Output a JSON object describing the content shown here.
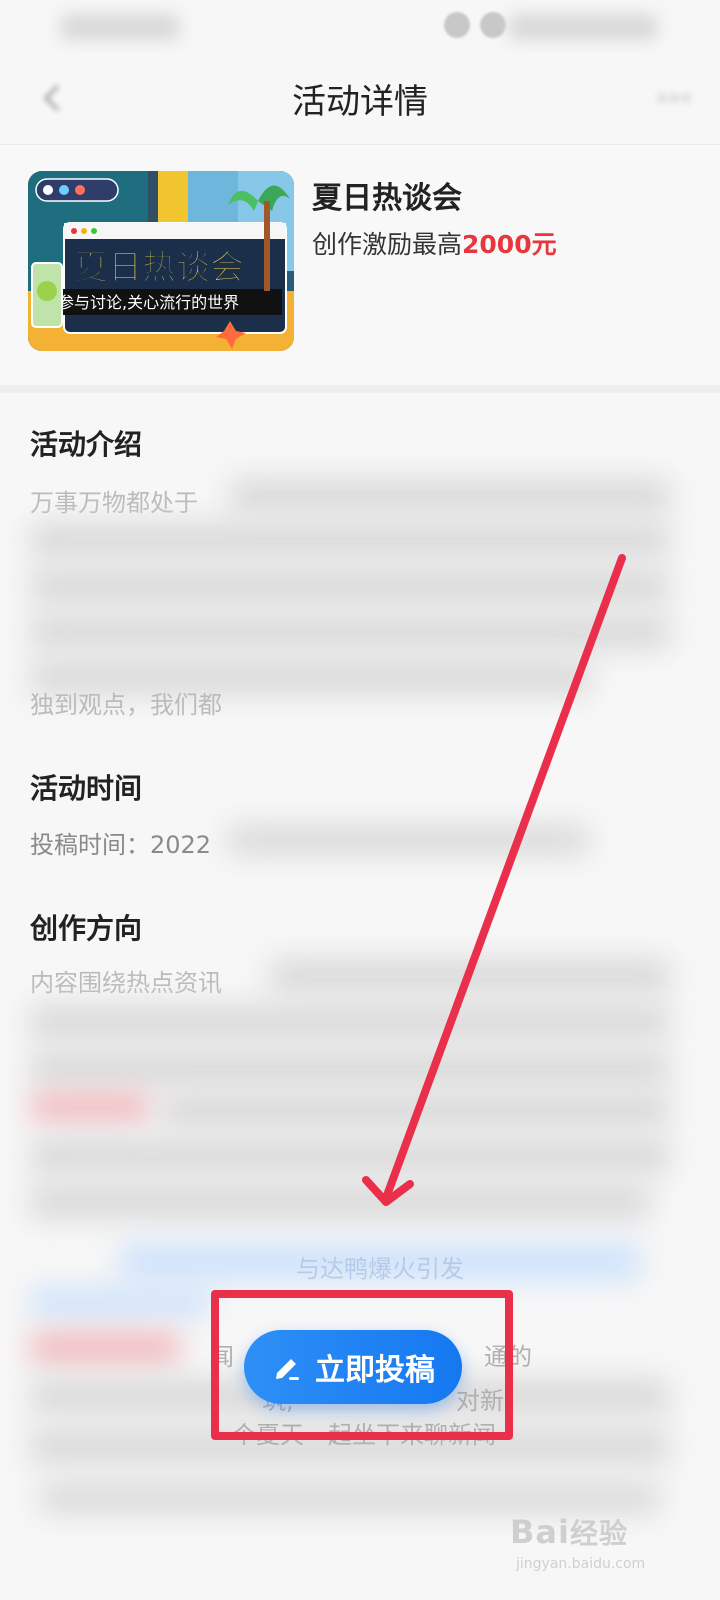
{
  "header": {
    "title": "活动详情"
  },
  "activity": {
    "title": "夏日热谈会",
    "reward_prefix": "创作激励最高",
    "reward_amount": "2000元",
    "banner": {
      "headline": "夏日热谈会",
      "tagline": "参与讨论,关心流行的世界"
    }
  },
  "sections": {
    "intro": {
      "title": "活动介绍",
      "line1": "万事万物都处于",
      "line2": "独到观点，我们都"
    },
    "time": {
      "title": "活动时间",
      "line1": "投稿时间：2022"
    },
    "direction": {
      "title": "创作方向",
      "line1": "内容围绕热点资讯",
      "partial1": "与达鸭爆火引发",
      "partial2": "闻",
      "partial3": "通的",
      "partial4": "筑,",
      "partial5": "对新",
      "partial6": "个夏天一起坐下来聊新闻"
    }
  },
  "submit_button": {
    "label": "立即投稿",
    "icon": "pen-icon"
  },
  "watermark": {
    "brand": "Bai",
    "brand_cn": "经验",
    "url": "jingyan.baidu.com"
  },
  "colors": {
    "accent": "#1578f0",
    "highlight": "#ea2f4b",
    "reward": "#e8353e"
  }
}
